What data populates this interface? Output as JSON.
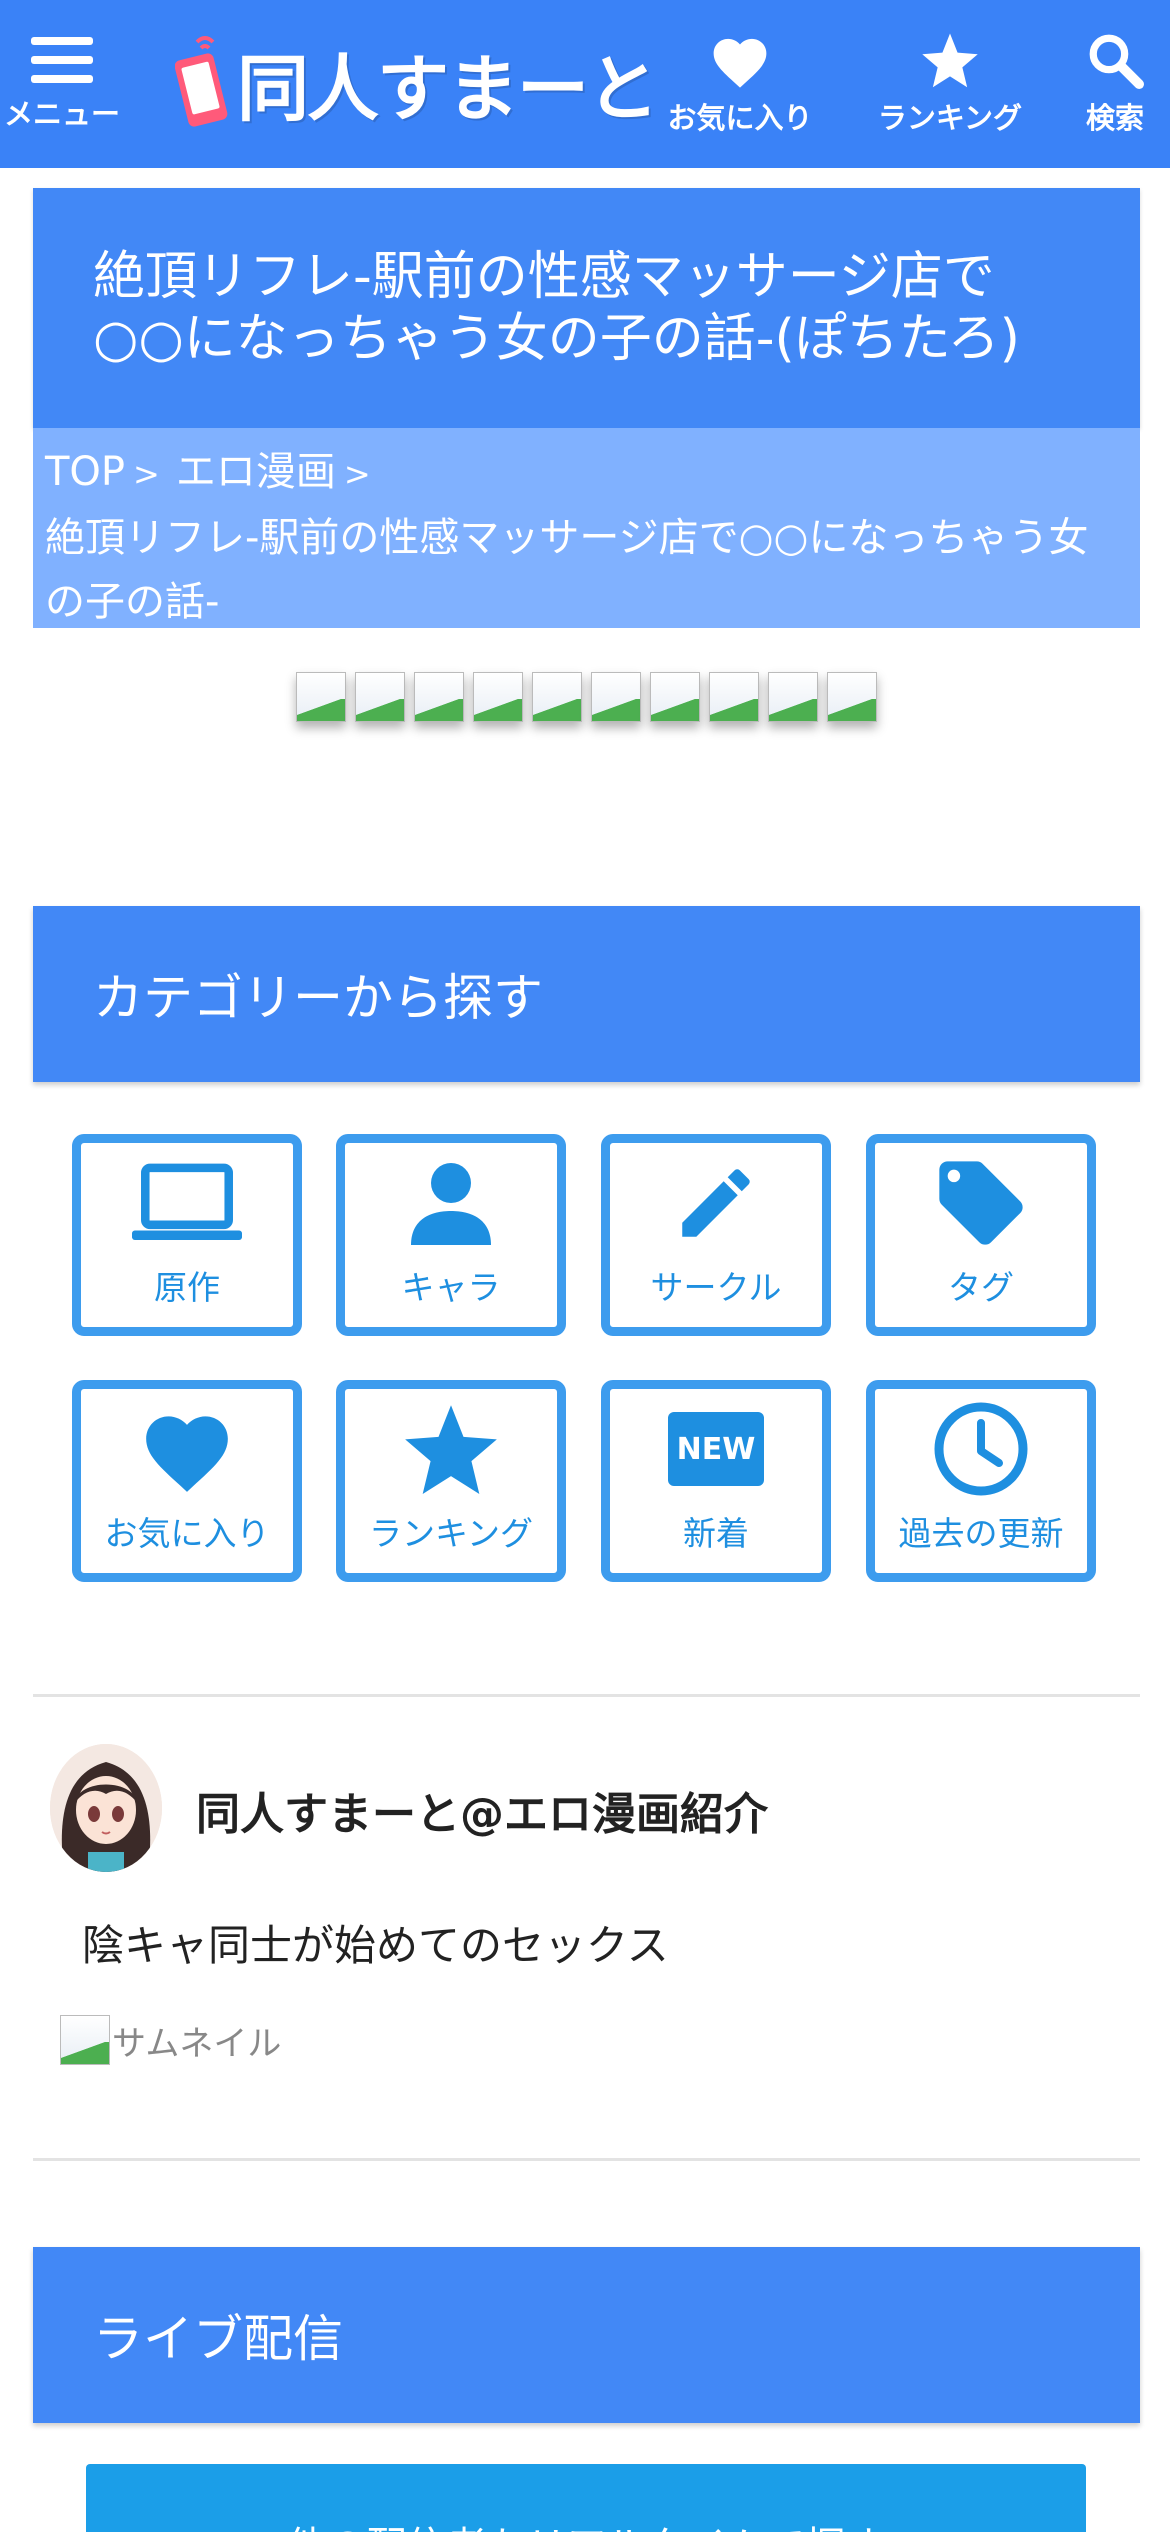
{
  "header": {
    "menu_label": "メニュー",
    "logo_text": "同人すまーと",
    "favorites_label": "お気に入り",
    "ranking_label": "ランキング",
    "search_label": "検索",
    "bg_color": "#3a82f7"
  },
  "article": {
    "title": "絶頂リフレ-駅前の性感マッサージ店で○○になっちゃう女の子の話-(ぽちたろ)"
  },
  "breadcrumb": {
    "items": [
      {
        "label": "TOP",
        "sep": ">"
      },
      {
        "label": "エロ漫画",
        "sep": ">"
      }
    ],
    "current": "絶頂リフレ-駅前の性感マッサージ店で○○になっちゃう女の子の話-"
  },
  "categories": {
    "heading": "カテゴリーから探す",
    "items": [
      {
        "label": "原作",
        "icon": "laptop-icon"
      },
      {
        "label": "キャラ",
        "icon": "person-icon"
      },
      {
        "label": "サークル",
        "icon": "pencil-icon"
      },
      {
        "label": "タグ",
        "icon": "tag-icon"
      },
      {
        "label": "お気に入り",
        "icon": "heart-icon"
      },
      {
        "label": "ランキング",
        "icon": "star-icon"
      },
      {
        "label": "新着",
        "icon": "new-badge-icon",
        "badge_text": "NEW"
      },
      {
        "label": "過去の更新",
        "icon": "clock-icon"
      }
    ],
    "accent_color": "#3d9cee"
  },
  "author_card": {
    "name": "同人すまーと@エロ漫画紹介",
    "post_title": "陰キャ同士が始めてのセックス",
    "thumbnail_alt": "サムネイル"
  },
  "live": {
    "heading": "ライブ配信",
    "cta_label": "他の配信者もリアルタイムで探す"
  }
}
